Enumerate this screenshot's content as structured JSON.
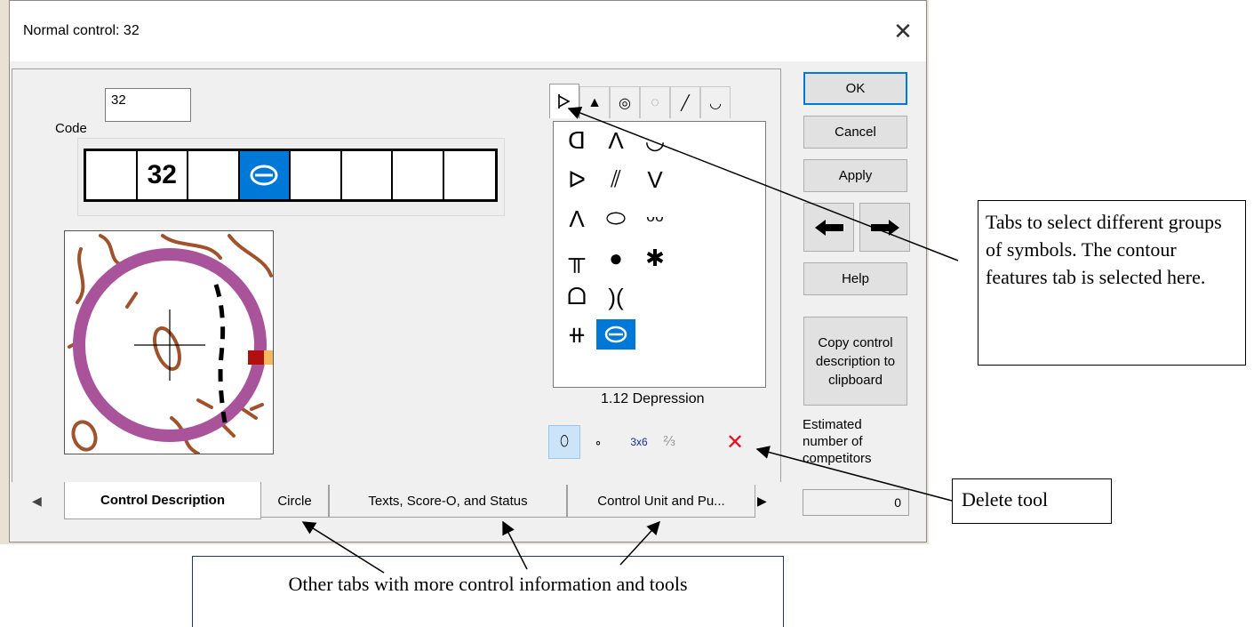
{
  "window": {
    "title": "Normal control: 32",
    "close_glyph": "✕"
  },
  "code": {
    "label": "Code",
    "value": "32"
  },
  "description_strip": {
    "cells": [
      "",
      "32",
      "",
      "⊖",
      "",
      "",
      "",
      ""
    ],
    "selected_index": 3
  },
  "symbol_tabs": [
    "⏵",
    "▲",
    "◎",
    "◌",
    "╱",
    "◡"
  ],
  "symbol_grid": [
    [
      "ᗡ",
      "Λ",
      "◡"
    ],
    [
      "ᐅ",
      "⫽",
      "V"
    ],
    [
      "Λ",
      "⬭",
      "ᵕᵕ"
    ],
    [
      "╥",
      "●",
      "✱"
    ],
    [
      "ᗝ",
      ")("
    ],
    [
      "⧺",
      "⊖"
    ]
  ],
  "selected_symbol": "⊖",
  "symbol_name": "1.12 Depression",
  "tools": [
    "⬯",
    "∘",
    "3x6",
    "⅔",
    "✕"
  ],
  "buttons": {
    "ok": "OK",
    "cancel": "Cancel",
    "apply": "Apply",
    "help": "Help",
    "copy": "Copy control description to clipboard"
  },
  "estimated": {
    "label": "Estimated number of competitors",
    "value": "0"
  },
  "bottom_tabs": [
    "Control Description",
    "Circle",
    "Texts, Score-O, and Status",
    "Control Unit and Pu..."
  ],
  "callouts": {
    "tabs": "Tabs to select different groups of symbols. The contour features tab is selected here.",
    "delete": "Delete tool",
    "other": "Other tabs with more control information and tools"
  },
  "colors": {
    "accent": "#0078d7",
    "circle": "#a8539a",
    "contour": "#a0522d",
    "delete": "#e81123"
  }
}
